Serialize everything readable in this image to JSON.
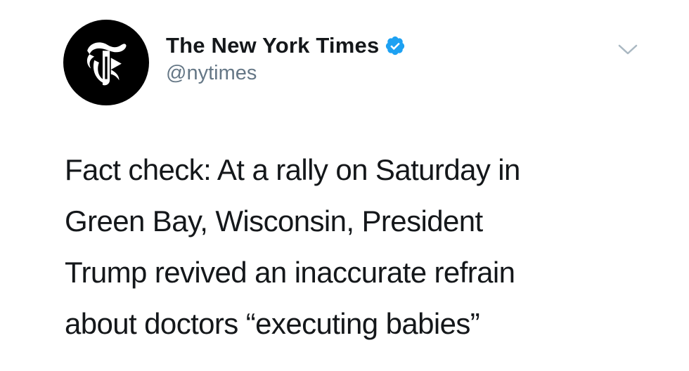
{
  "tweet": {
    "author": {
      "display_name": "The New York Times",
      "handle": "@nytimes",
      "verified": true,
      "avatar_icon": "nyt-t-logo-icon"
    },
    "text_lines": [
      "Fact check: At a rally on Saturday in",
      "Green Bay, Wisconsin, President",
      "Trump revived an inaccurate refrain",
      "about doctors “executing babies”"
    ],
    "menu_icon": "chevron-down-icon"
  },
  "colors": {
    "text_primary": "#14171a",
    "text_secondary": "#657786",
    "verified_blue": "#1da1f2",
    "avatar_bg": "#000000",
    "caret": "#aab8c2"
  }
}
